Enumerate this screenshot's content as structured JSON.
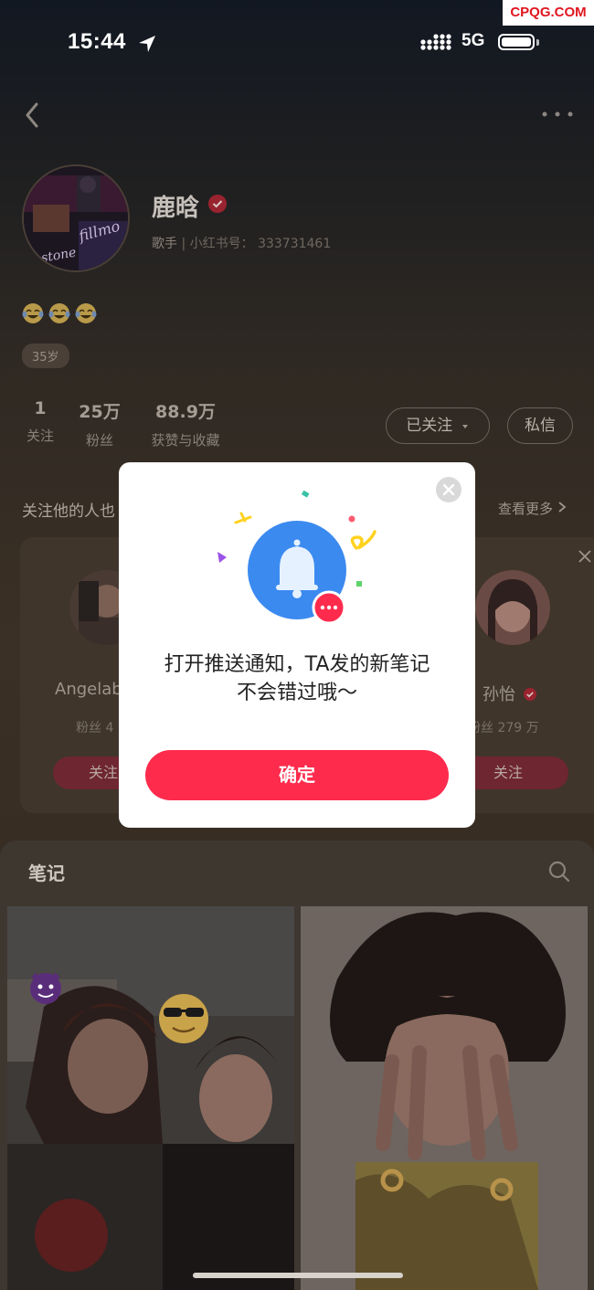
{
  "watermark": "CPQG.COM",
  "status_bar": {
    "time": "15:44",
    "network": "5G"
  },
  "profile": {
    "name": "鹿晗",
    "role": "歌手",
    "id_label": "小红书号：",
    "id_value": "333731461",
    "emoji_bio": "😂😂😂",
    "age_tag": "35岁",
    "stats": [
      {
        "value": "1",
        "label": "关注"
      },
      {
        "value": "25万",
        "label": "粉丝"
      },
      {
        "value": "88.9万",
        "label": "获赞与收藏"
      }
    ],
    "followed_label": "已关注",
    "message_label": "私信"
  },
  "recommend": {
    "title": "关注他的人也",
    "see_more": "查看更多",
    "cards": [
      {
        "name": "Angelab",
        "fans": "粉丝 4",
        "follow": "关注"
      },
      {
        "name": "孙怡",
        "fans": "粉丝 279 万",
        "follow": "关注"
      }
    ]
  },
  "notes": {
    "tab_label": "笔记"
  },
  "modal": {
    "line1": "打开推送通知，TA发的新笔记",
    "line2": "不会错过哦～",
    "confirm_label": "确定"
  },
  "colors": {
    "accent": "#fe2b4d",
    "verified": "#e0283d"
  }
}
